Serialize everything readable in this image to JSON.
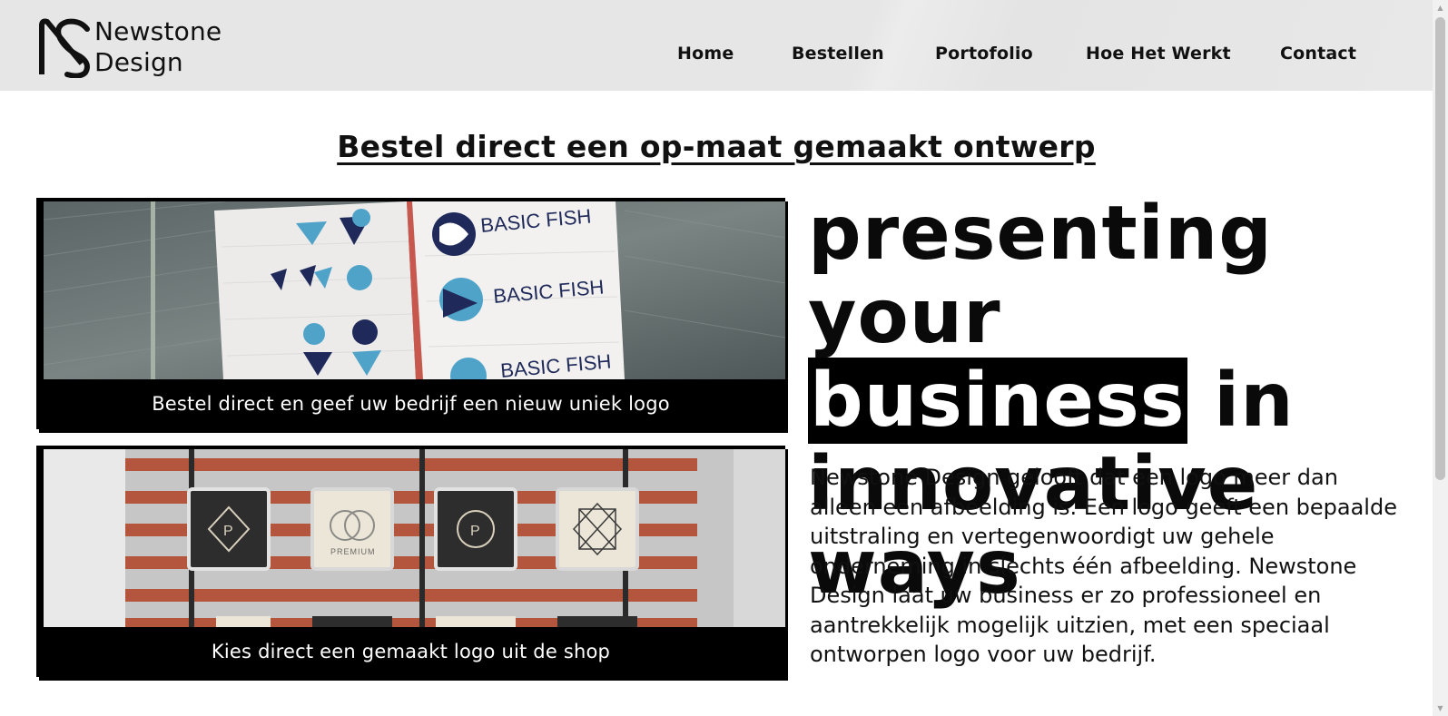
{
  "header": {
    "brand_line1": "Newstone",
    "brand_line2": "Design",
    "nav": [
      "Home",
      "Bestellen",
      "Portofolio",
      "Hoe Het Werkt",
      "Contact"
    ]
  },
  "main": {
    "section_title": "Bestel direct een op-maat gemaakt ontwerp",
    "cards": [
      {
        "caption": "Bestel direct en geef uw bedrijf een nieuw uniek logo",
        "image_text": [
          "BASIC FISH",
          "BASIC FISH",
          "BASIC FISH"
        ]
      },
      {
        "caption": "Kies direct een gemaakt logo uit de shop",
        "image_text": [
          "P",
          "PREMIUM",
          "P"
        ]
      }
    ],
    "hero": {
      "line1": "presenting your",
      "highlight": "business",
      "line2_rest": " in",
      "line3": "innovative ways",
      "paragraph": "Newstone Design gelooft dat een logo meer dan alleen een afbeelding is. Een logo geeft een bepaalde uitstraling en vertegenwoordigt uw gehele onderneming in slechts één afbeelding. Newstone Design laat uw business er zo professioneel en aantrekkelijk mogelijk uitzien, met een speciaal ontworpen logo voor uw bedrijf."
    }
  },
  "colors": {
    "header_bg": "#e6e6e6",
    "card_bg": "#000000",
    "fish_dark": "#1f2a5a",
    "fish_light": "#4fa3c9",
    "shelf": "#b4553d"
  },
  "icons": {
    "brand": "ns-monogram-icon",
    "scroll_up": "triangle-up-icon",
    "scroll_down": "triangle-down-icon"
  }
}
